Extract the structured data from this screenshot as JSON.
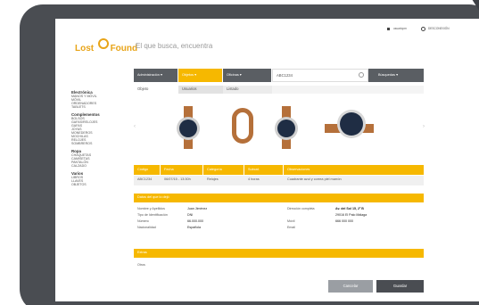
{
  "header": {
    "logo_lost": "Lost",
    "logo_found": "Found",
    "tagline": "El que busca, encuentra",
    "user_label": "usuariopm",
    "logout_label": "DESCONEXIÓN"
  },
  "sidebar": {
    "groups": [
      {
        "title": "Electrónica",
        "items": [
          "MANOS Y MÓVIL",
          "MÓVIL",
          "ORDENADORES",
          "TABLETS"
        ]
      },
      {
        "title": "Complementos",
        "items": [
          "BOLSOS",
          "GAFAS/RELOJES",
          "GAFAS",
          "JOYAS",
          "MONEDEROS",
          "MOCHILAS",
          "RELOJES",
          "SOMBREROS"
        ]
      },
      {
        "title": "Ropa",
        "items": [
          "CHAQUETAS",
          "CAMISETAS",
          "PANTALÓN",
          "CALZADO"
        ]
      },
      {
        "title": "Varios",
        "items": [
          "LIBROS",
          "LLAVES",
          "OBJETOS"
        ]
      }
    ]
  },
  "topnav": {
    "dropdowns": [
      "Administración",
      "Objetos",
      "Oficinas"
    ],
    "search_value": "ABC1234",
    "right_label": "Búsquedas"
  },
  "tabs": [
    "Objeto",
    "Usuarios",
    "Listado"
  ],
  "object_table": {
    "headers": [
      "Código",
      "Fecha",
      "Categoría",
      "Subcat.",
      "Observaciones"
    ],
    "row": [
      "ABC1234",
      "06/07/15 - 13:30h",
      "Relojes",
      "4 horas",
      "Cuadrante azul y correa piel marrón"
    ]
  },
  "finder": {
    "section_title": "Datos del que lo dejó",
    "left_labels": [
      "Nombre y Apellidos",
      "Tipo de Identificación",
      "Número",
      "Nacionalidad"
    ],
    "left_values": [
      "Juan Jiménez",
      "DNI",
      "66.000.000",
      "Española"
    ],
    "right_labels": [
      "Dirección completa",
      "",
      "Móvil",
      "Email"
    ],
    "right_values": [
      "Av. del Sol 15, 2º B",
      "29016 El Palo Málaga",
      "666 000 000",
      ""
    ]
  },
  "notes": {
    "section_title": "Extras",
    "value": "Otros"
  },
  "actions": {
    "cancel": "Cancelar",
    "save": "Guardar"
  },
  "colors": {
    "accent": "#f6b800",
    "dark": "#4a4d52",
    "nav": "#5a5e63"
  }
}
